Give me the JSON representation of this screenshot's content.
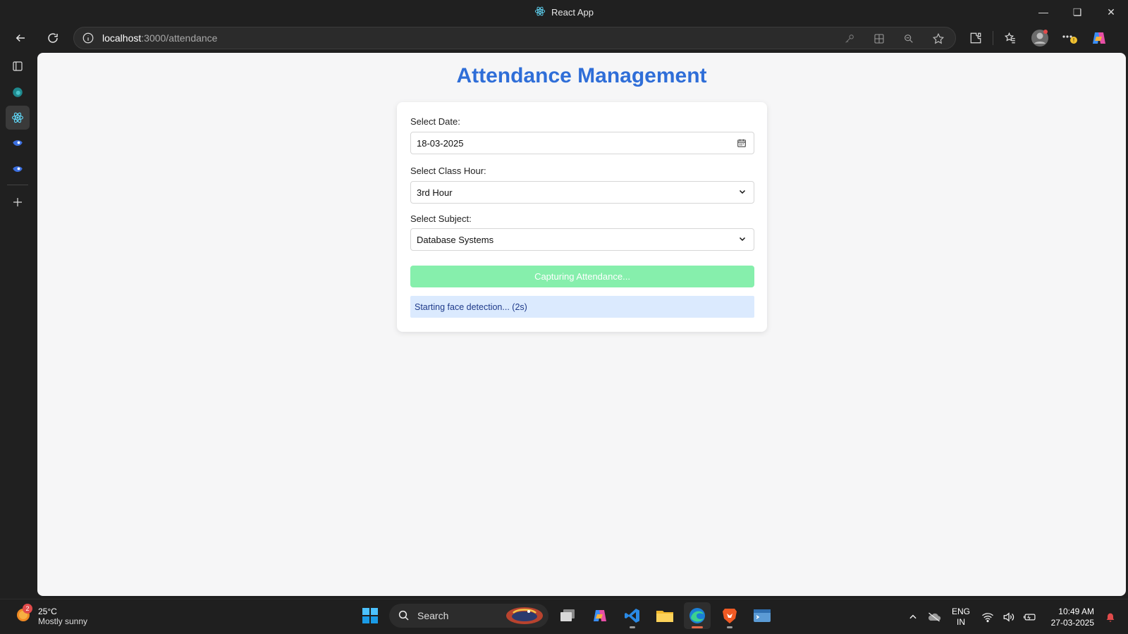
{
  "window": {
    "title": "React App"
  },
  "browser": {
    "url_host": "localhost",
    "url_path": ":3000/attendance"
  },
  "page": {
    "title": "Attendance Management",
    "date_label": "Select Date:",
    "date_value": "18-03-2025",
    "hour_label": "Select Class Hour:",
    "hour_value": "3rd Hour",
    "subject_label": "Select Subject:",
    "subject_value": "Database Systems",
    "capture_button": "Capturing Attendance...",
    "status_message": "Starting face detection... (2s)"
  },
  "taskbar": {
    "weather_badge": "2",
    "temperature": "25°C",
    "weather_desc": "Mostly sunny",
    "search_label": "Search",
    "lang_line1": "ENG",
    "lang_line2": "IN",
    "time": "10:49 AM",
    "date": "27-03-2025"
  },
  "colors": {
    "title_blue": "#2f6ed8",
    "button_green": "#86efac",
    "status_blue_bg": "#dbeafe"
  }
}
